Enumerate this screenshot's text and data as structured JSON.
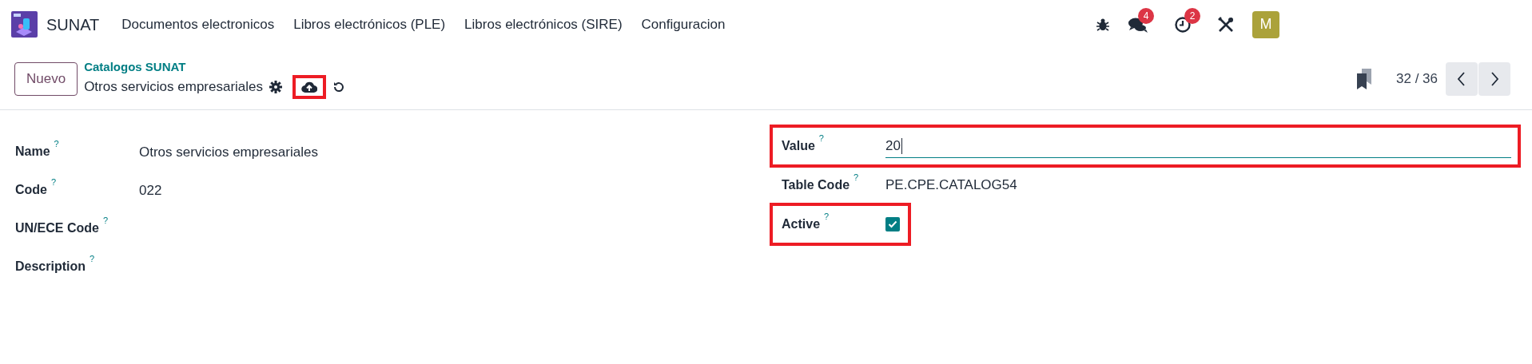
{
  "navbar": {
    "app_name": "SUNAT",
    "menu": [
      {
        "label": "Documentos electronicos"
      },
      {
        "label": "Libros electrónicos (PLE)"
      },
      {
        "label": "Libros electrónicos (SIRE)"
      },
      {
        "label": "Configuracion"
      }
    ],
    "systray": [
      {
        "kind": "bug"
      },
      {
        "kind": "chat",
        "badge": "4"
      },
      {
        "kind": "clock",
        "badge": "2"
      },
      {
        "kind": "tools"
      }
    ],
    "avatar": "M"
  },
  "control_panel": {
    "new_button": "Nuevo",
    "breadcrumb": "Catalogos SUNAT",
    "record_title": "Otros servicios empresariales",
    "save_highlighted": true,
    "pager": "32 / 36"
  },
  "form": {
    "left": [
      {
        "label": "Name",
        "value": "Otros servicios empresariales"
      },
      {
        "label": "Code",
        "value": "022"
      },
      {
        "label": "UN/ECE Code"
      },
      {
        "label": "Description"
      }
    ],
    "right": [
      {
        "kind": "input",
        "label": "Value",
        "value": "20",
        "highlighted": true
      },
      {
        "kind": "text",
        "label": "Table Code",
        "value": "PE.CPE.CATALOG54",
        "highlighted": false
      },
      {
        "kind": "checkbox",
        "label": "Active",
        "checked": true,
        "highlighted": true
      }
    ],
    "help_mark": "?"
  }
}
